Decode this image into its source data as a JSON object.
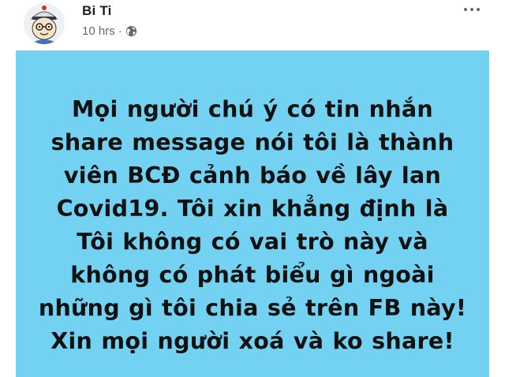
{
  "post": {
    "author": {
      "name": "Bi Ti",
      "avatar_icon": "cartoon-face-avatar-icon"
    },
    "meta": {
      "timestamp": "10 hrs",
      "separator": "·",
      "audience_icon": "globe-icon"
    },
    "more_icon": "more-options-icon",
    "status": {
      "background_color": "#73d2f2",
      "text": "Mọi người chú ý có tin nhắn share message nói tôi là thành viên BCĐ cảnh báo về lây lan Covid19. Tôi xin khẳng định là Tôi không có vai trò này và không có phát biểu gì ngoài những gì tôi chia sẻ trên FB này! Xin mọi người xoá và ko share!"
    }
  }
}
